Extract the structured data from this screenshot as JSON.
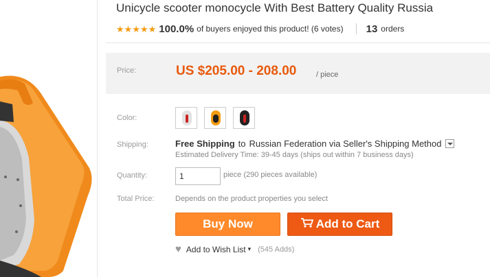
{
  "product": {
    "title": "Unicycle scooter monocycle With Best Battery Quality Russia"
  },
  "rating": {
    "stars": 5,
    "percent": "100.0%",
    "text": "of buyers enjoyed this product! (6 votes)",
    "orders_count": "13",
    "orders_label": "orders"
  },
  "price": {
    "label": "Price:",
    "value": "US $205.00 - 208.00",
    "unit": "/ piece"
  },
  "color": {
    "label": "Color:",
    "options": [
      {
        "name": "white",
        "color": "#dddddd",
        "accent": "#cc2222"
      },
      {
        "name": "orange",
        "color": "#f39c12",
        "accent": "#222222"
      },
      {
        "name": "black",
        "color": "#222222",
        "accent": "#cc2222"
      }
    ]
  },
  "shipping": {
    "label": "Shipping:",
    "free": "Free Shipping",
    "to": "to",
    "destination": "Russian Federation via Seller's Shipping Method",
    "delivery": "Estimated Delivery Time: 39-45 days (ships out within 7 business days)"
  },
  "quantity": {
    "label": "Quantity:",
    "value": "1",
    "note": "piece (290 pieces available)"
  },
  "total": {
    "label": "Total Price:",
    "text": "Depends on the product properties you select"
  },
  "actions": {
    "buy_now": "Buy Now",
    "add_to_cart": "Add to Cart",
    "wish_list": "Add to Wish List",
    "wish_count": "(545 Adds)"
  },
  "colors": {
    "accent": "#e8590c",
    "buy_button": "#ff8a2b",
    "cart_button": "#ee5a14",
    "star": "#f39c12"
  }
}
